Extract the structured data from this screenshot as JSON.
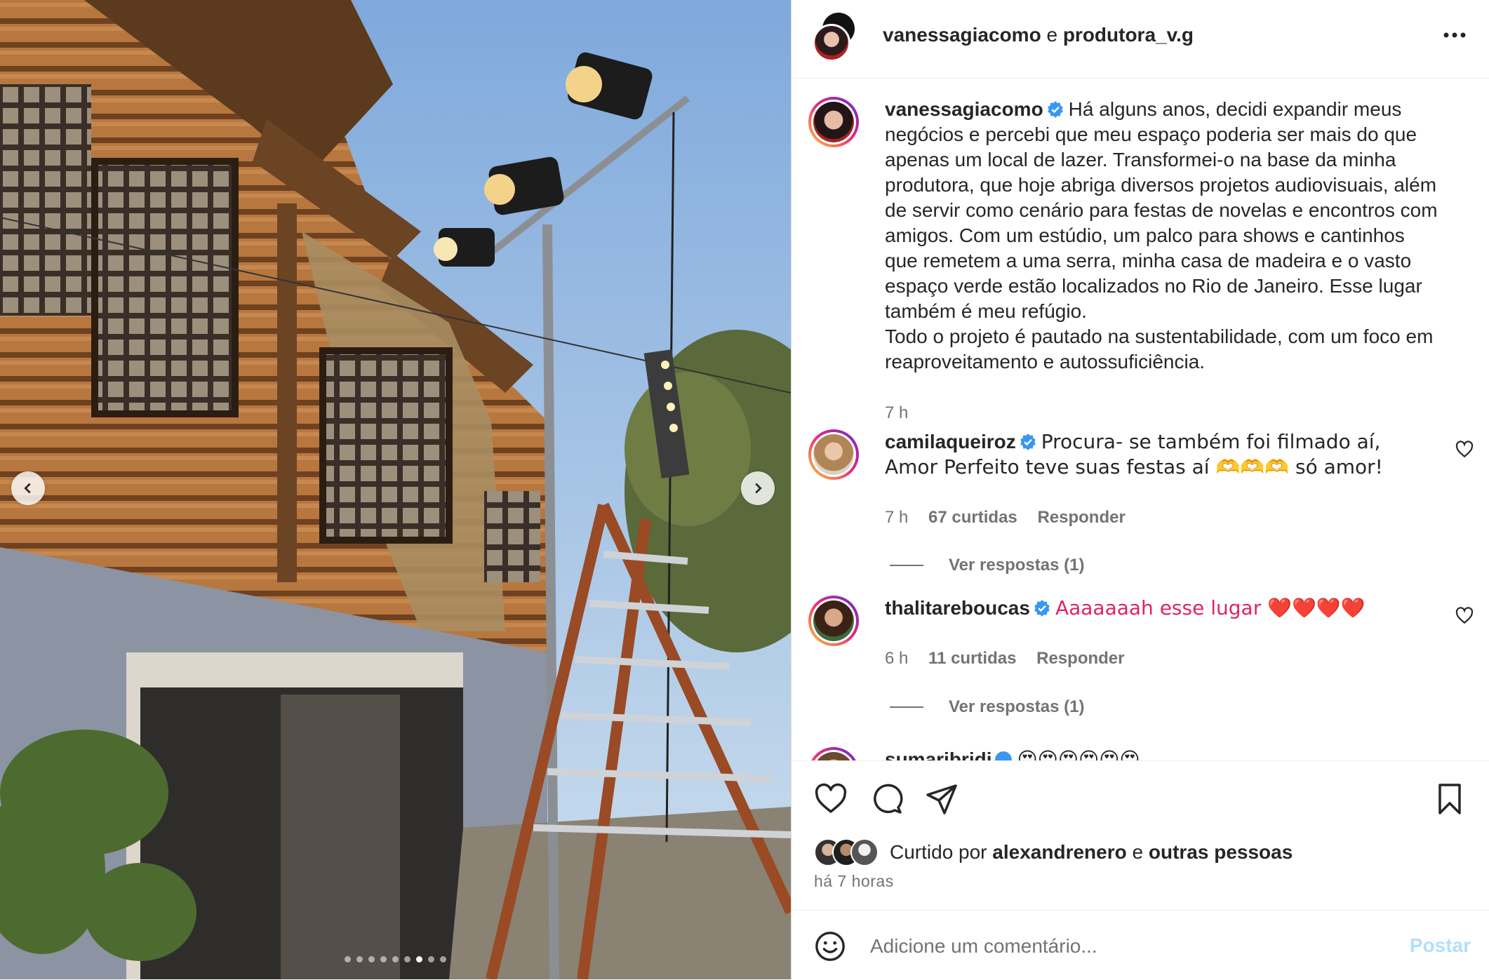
{
  "post": {
    "author": "vanessagiacomo",
    "joiner": "e",
    "collaborator": "produtora_v.g"
  },
  "caption": {
    "username": "vanessagiacomo",
    "text": "Há alguns anos, decidi expandir meus negócios e percebi que meu espaço poderia ser mais do que apenas um local de lazer. Transformei-o na base da minha produtora, que hoje abriga diversos projetos audiovisuais, além de servir como cenário para festas de novelas e encontros com amigos. Com um estúdio, um palco para shows e cantinhos que remetem a uma serra, minha casa de madeira e o vasto espaço verde estão localizados no Rio de Janeiro. Esse lugar também é meu refúgio.",
    "text2": "Todo o projeto é pautado na sustentabilidade, com um foco em reaproveitamento e autossuficiência.",
    "time": "7 h"
  },
  "comments": [
    {
      "username": "camilaqueiroz",
      "text": "Procura- se também foi filmado aí, Amor Perfeito teve suas festas aí 🫶🫶🫶 só amor!",
      "time": "7 h",
      "likes": "67 curtidas",
      "reply": "Responder",
      "view_replies": "Ver respostas (1)"
    },
    {
      "username": "thalitareboucas",
      "text": "Aaaaaaah esse lugar ❤️❤️❤️❤️",
      "time": "6 h",
      "likes": "11 curtidas",
      "reply": "Responder",
      "view_replies": "Ver respostas (1)"
    },
    {
      "username": "sumaribridi",
      "text": "😍😍😍😍😍😍"
    }
  ],
  "likes_summary": {
    "prefix": "Curtido por",
    "user": "alexandrenero",
    "joiner": "e",
    "others": "outras pessoas"
  },
  "time_ago": "há 7 horas",
  "comment_box": {
    "placeholder": "Adicione um comentário...",
    "post_label": "Postar"
  },
  "carousel": {
    "total_slides": 9,
    "active_index": 6
  },
  "colors": {
    "verified": "#3897f0",
    "link_disabled": "#b2dffc",
    "muted": "#737373",
    "heart_red": "#e0245e"
  },
  "icons": [
    "chevron-left-icon",
    "chevron-right-icon",
    "more-icon",
    "verified-icon",
    "heart-icon",
    "comment-icon",
    "share-icon",
    "bookmark-icon",
    "smile-icon"
  ]
}
